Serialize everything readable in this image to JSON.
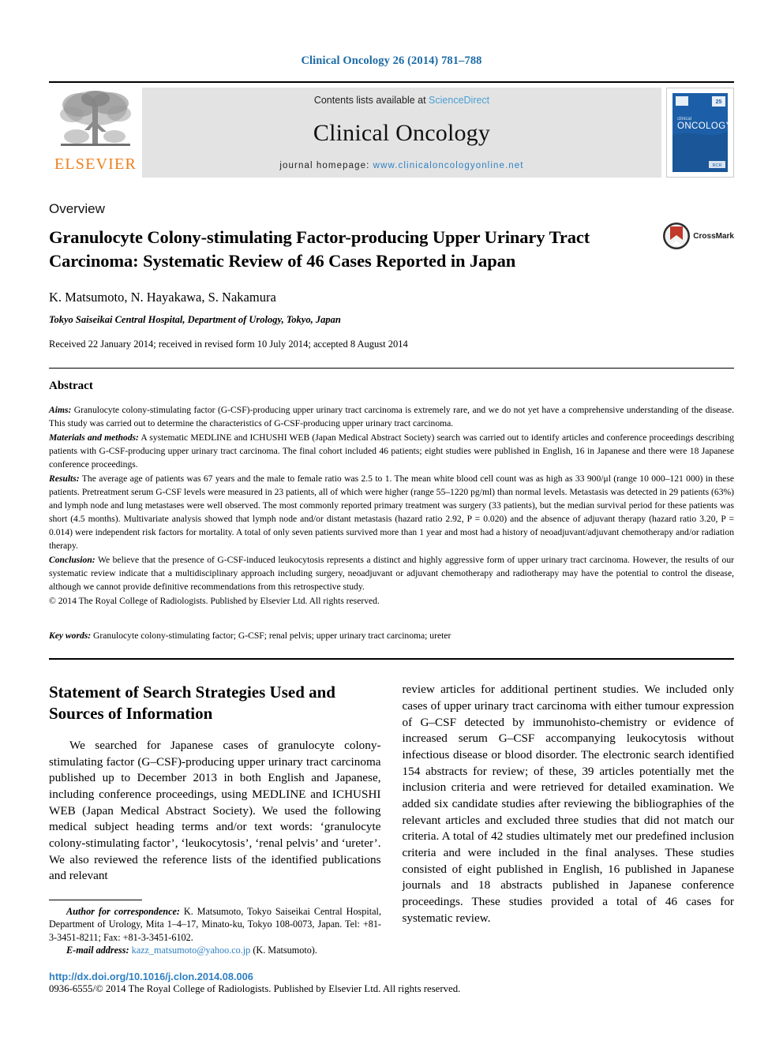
{
  "running_head": "Clinical Oncology 26 (2014) 781–788",
  "masthead": {
    "publisher_name": "ELSEVIER",
    "contents_prefix": "Contents lists available at ",
    "contents_link": "ScienceDirect",
    "journal_title": "Clinical Oncology",
    "homepage_prefix": "journal homepage: ",
    "homepage_url": "www.clinicaloncologyonline.net",
    "cover_title_small": "clinical",
    "cover_title_large": "ONCOLOGY",
    "cover_badge": "25",
    "cover_footer": "RCR"
  },
  "article": {
    "doc_type": "Overview",
    "title": "Granulocyte Colony-stimulating Factor-producing Upper Urinary Tract Carcinoma: Systematic Review of 46 Cases Reported in Japan",
    "crossmark_label": "CrossMark",
    "authors": "K. Matsumoto, N. Hayakawa, S. Nakamura",
    "affiliation": "Tokyo Saiseikai Central Hospital, Department of Urology, Tokyo, Japan",
    "history": "Received 22 January 2014; received in revised form 10 July 2014; accepted 8 August 2014"
  },
  "abstract": {
    "heading": "Abstract",
    "paragraphs": [
      {
        "label": "Aims:",
        "text": " Granulocyte colony-stimulating factor (G-CSF)-producing upper urinary tract carcinoma is extremely rare, and we do not yet have a comprehensive understanding of the disease. This study was carried out to determine the characteristics of G-CSF-producing upper urinary tract carcinoma."
      },
      {
        "label": "Materials and methods:",
        "text": " A systematic MEDLINE and ICHUSHI WEB (Japan Medical Abstract Society) search was carried out to identify articles and conference proceedings describing patients with G-CSF-producing upper urinary tract carcinoma. The final cohort included 46 patients; eight studies were published in English, 16 in Japanese and there were 18 Japanese conference proceedings."
      },
      {
        "label": "Results:",
        "text": " The average age of patients was 67 years and the male to female ratio was 2.5 to 1. The mean white blood cell count was as high as 33 900/μl (range 10 000–121 000) in these patients. Pretreatment serum G-CSF levels were measured in 23 patients, all of which were higher (range 55–1220 pg/ml) than normal levels. Metastasis was detected in 29 patients (63%) and lymph node and lung metastases were well observed. The most commonly reported primary treatment was surgery (33 patients), but the median survival period for these patients was short (4.5 months). Multivariate analysis showed that lymph node and/or distant metastasis (hazard ratio 2.92, P = 0.020) and the absence of adjuvant therapy (hazard ratio 3.20, P = 0.014) were independent risk factors for mortality. A total of only seven patients survived more than 1 year and most had a history of neoadjuvant/adjuvant chemotherapy and/or radiation therapy."
      },
      {
        "label": "Conclusion:",
        "text": " We believe that the presence of G-CSF-induced leukocytosis represents a distinct and highly aggressive form of upper urinary tract carcinoma. However, the results of our systematic review indicate that a multidisciplinary approach including surgery, neoadjuvant or adjuvant chemotherapy and radiotherapy may have the potential to control the disease, although we cannot provide definitive recommendations from this retrospective study."
      }
    ],
    "copyright": "© 2014 The Royal College of Radiologists. Published by Elsevier Ltd. All rights reserved.",
    "keywords_label": "Key words:",
    "keywords_text": " Granulocyte colony-stimulating factor; G-CSF; renal pelvis; upper urinary tract carcinoma; ureter"
  },
  "body": {
    "section_heading": "Statement of Search Strategies Used and Sources of Information",
    "left_paragraph": "We searched for Japanese cases of granulocyte colony-stimulating factor (G–CSF)-producing upper urinary tract carcinoma published up to December 2013 in both English and Japanese, including conference proceedings, using MEDLINE and ICHUSHI WEB (Japan Medical Abstract Society). We used the following medical subject heading terms and/or text words: ‘granulocyte colony-stimulating factor’, ‘leukocytosis’, ‘renal pelvis’ and ‘ureter’. We also reviewed the reference lists of the identified publications and relevant",
    "right_paragraph": "review articles for additional pertinent studies. We included only cases of upper urinary tract carcinoma with either tumour expression of G–CSF detected by immunohisto-chemistry or evidence of increased serum G–CSF accompanying leukocytosis without infectious disease or blood disorder. The electronic search identified 154 abstracts for review; of these, 39 articles potentially met the inclusion criteria and were retrieved for detailed examination. We added six candidate studies after reviewing the bibliographies of the relevant articles and excluded three studies that did not match our criteria. A total of 42 studies ultimately met our predefined inclusion criteria and were included in the final analyses. These studies consisted of eight published in English, 16 published in Japanese journals and 18 abstracts published in Japanese conference proceedings. These studies provided a total of 46 cases for systematic review."
  },
  "footnotes": {
    "correspondence_label": "Author for correspondence:",
    "correspondence_text": " K. Matsumoto, Tokyo Saiseikai Central Hospital, Department of Urology, Mita 1–4–17, Minato-ku, Tokyo 108-0073, Japan. Tel: +81-3-3451-8211; Fax: +81-3-3451-6102.",
    "email_label": "E-mail address:",
    "email_address": "kazz_matsumoto@yahoo.co.jp",
    "email_suffix": " (K. Matsumoto).",
    "doi": "http://dx.doi.org/10.1016/j.clon.2014.08.006",
    "issn_line": "0936-6555/© 2014 The Royal College of Radiologists. Published by Elsevier Ltd. All rights reserved."
  },
  "colors": {
    "link_blue": "#2f80c2",
    "header_blue": "#1b6aa5",
    "elsevier_orange": "#ef7d1a",
    "masthead_gray": "#e3e3e3",
    "crossmark_red": "#c0392b"
  }
}
